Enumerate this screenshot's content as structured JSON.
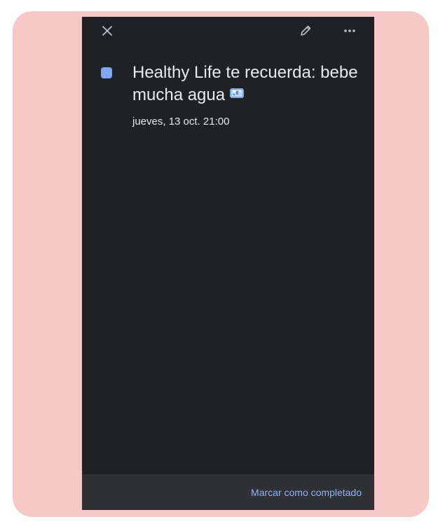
{
  "colors": {
    "background_accent": "#f6c8c7",
    "panel": "#202124",
    "bottom_bar": "#303134",
    "text": "#e8eaed",
    "link": "#8ab4f8",
    "task_color": "#7ba7f4"
  },
  "toolbar": {
    "close_icon": "close-icon",
    "edit_icon": "pencil-icon",
    "more_icon": "more-horizontal-icon"
  },
  "event": {
    "title": "Healthy Life te recuerda: bebe mucha agua",
    "emoji_icon": "ice-cube-icon",
    "datetime": "jueves, 13 oct. 21:00"
  },
  "footer": {
    "complete_label": "Marcar como completado"
  }
}
